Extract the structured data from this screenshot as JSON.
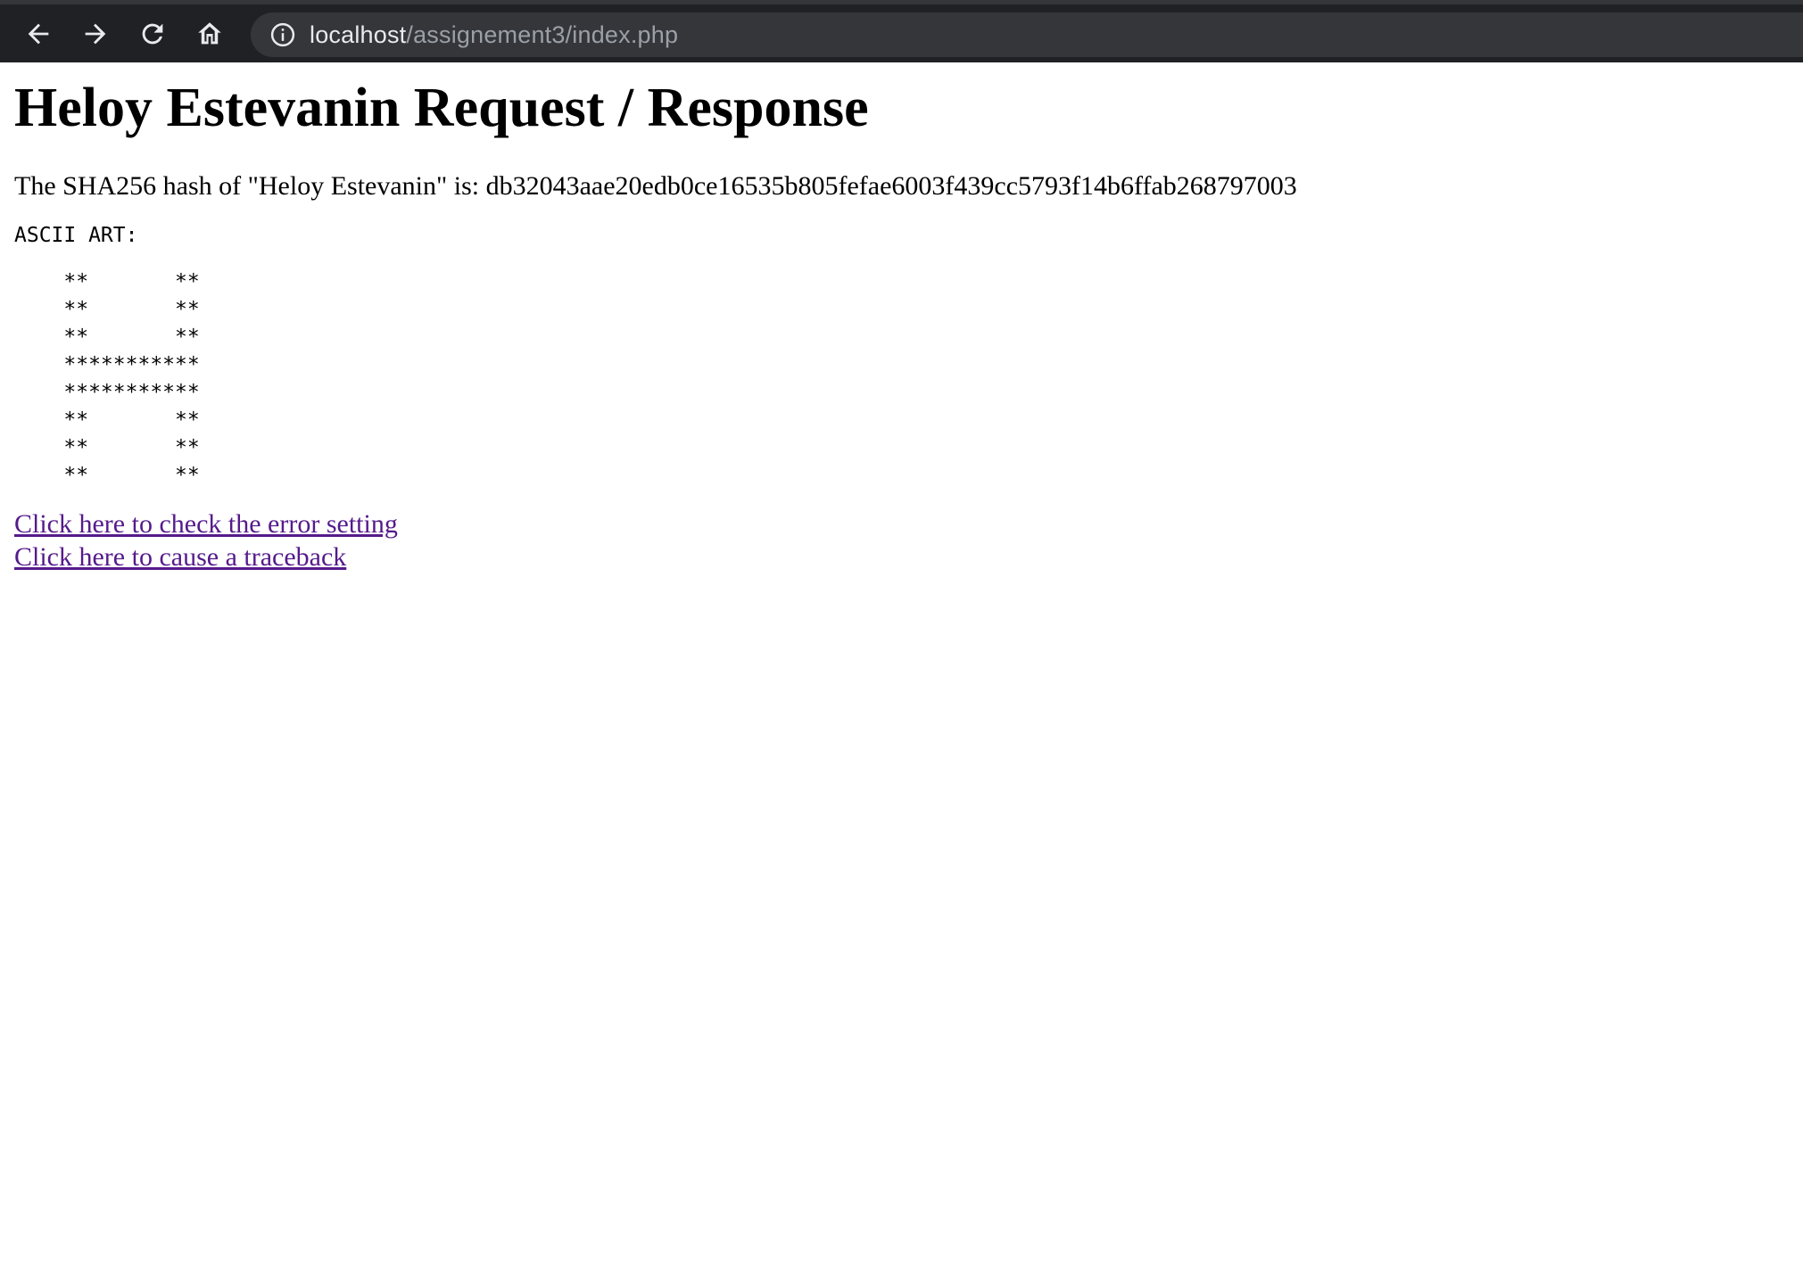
{
  "browser": {
    "url_host": "localhost",
    "url_path": "/assignement3/index.php",
    "icons": [
      "back-arrow-icon",
      "forward-arrow-icon",
      "reload-icon",
      "home-icon",
      "info-icon"
    ],
    "colors": {
      "toolbar_bg": "#202124",
      "omnibox_bg": "#35363a",
      "url_host": "#e8eaed",
      "url_path": "#9aa0a6"
    }
  },
  "page": {
    "title": "Heloy Estevanin Request / Response",
    "hash_text": "The SHA256 hash of \"Heloy Estevanin\" is: db32043aae20edb0ce16535b805fefae6003f439cc5793f14b6ffab268797003",
    "ascii_label": "ASCII ART:",
    "ascii_art": "    **       **\n    **       **\n    **       **\n    ***********\n    ***********\n    **       **\n    **       **\n    **       **",
    "links": [
      "Click here to check the error setting",
      "Click here to cause a traceback"
    ],
    "link_color": "#551a8b"
  }
}
